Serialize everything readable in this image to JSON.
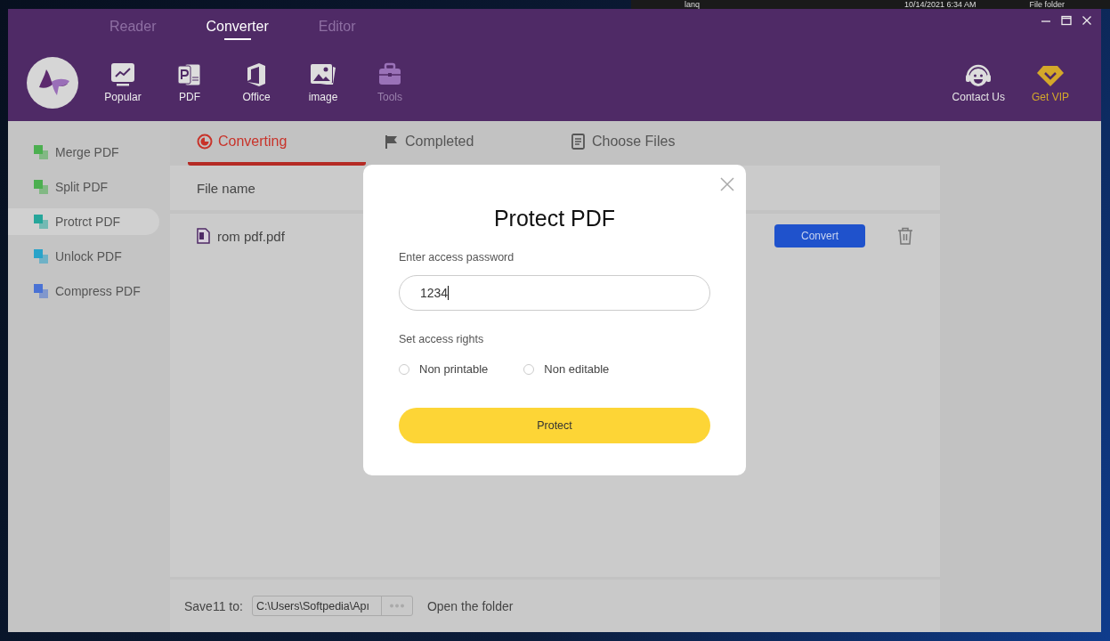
{
  "background_window": {
    "name": "lanq",
    "date": "10/14/2021 6:34 AM",
    "type": "File folder"
  },
  "top_tabs": [
    {
      "label": "Reader",
      "selected": false
    },
    {
      "label": "Converter",
      "selected": true
    },
    {
      "label": "Editor",
      "selected": false
    }
  ],
  "toolbar": [
    {
      "kind": "popular",
      "label": "Popular",
      "disabled": false
    },
    {
      "kind": "pdf",
      "label": "PDF",
      "disabled": false
    },
    {
      "kind": "office",
      "label": "Office",
      "disabled": false
    },
    {
      "kind": "image",
      "label": "image",
      "disabled": false
    },
    {
      "kind": "tools",
      "label": "Tools",
      "disabled": true
    }
  ],
  "header_actions": [
    {
      "kind": "contact",
      "label": "Contact Us"
    },
    {
      "kind": "vip",
      "label": "Get VIP"
    }
  ],
  "sidebar": {
    "items": [
      {
        "label": "Merge PDF",
        "color": "#4caf50",
        "selected": false
      },
      {
        "label": "Split PDF",
        "color": "#4caf50",
        "selected": false
      },
      {
        "label": "Protrct PDF",
        "color": "#26a69a",
        "selected": true
      },
      {
        "label": "Unlock PDF",
        "color": "#29a3c9",
        "selected": false
      },
      {
        "label": "Compress PDF",
        "color": "#4a72d4",
        "selected": false
      }
    ]
  },
  "content_tabs": [
    {
      "kind": "converting",
      "label": "Converting",
      "selected": true
    },
    {
      "kind": "completed",
      "label": "Completed",
      "selected": false
    },
    {
      "kind": "choose",
      "label": "Choose Files",
      "selected": false
    }
  ],
  "table": {
    "columns": [
      "File name"
    ],
    "rows": [
      {
        "name": "rom pdf.pdf",
        "action": "Convert"
      }
    ]
  },
  "footer": {
    "label": "Save11 to:",
    "path": "C:\\Users\\Softpedia\\Apı",
    "open": "Open the folder"
  },
  "dialog": {
    "title": "Protect PDF",
    "password_label": "Enter access password",
    "password": "1234",
    "rights_label": "Set access rights",
    "options": [
      {
        "label": "Non printable",
        "checked": false
      },
      {
        "label": "Non editable",
        "checked": false
      }
    ],
    "button": "Protect"
  }
}
